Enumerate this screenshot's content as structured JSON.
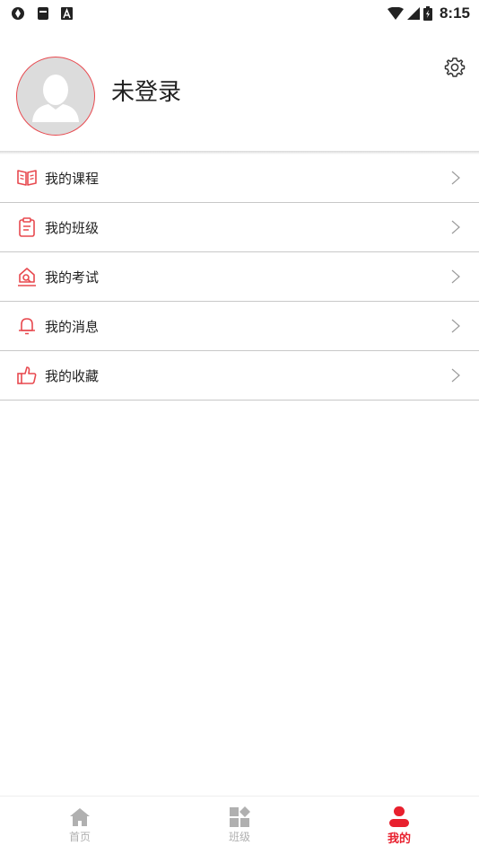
{
  "status_bar": {
    "time": "8:15",
    "icons_left": [
      "sync-icon",
      "sim-icon",
      "a-icon"
    ],
    "icons_right": [
      "wifi-icon",
      "signal-icon",
      "battery-icon"
    ]
  },
  "header": {
    "username": "未登录",
    "avatar_icon": "default-avatar-icon",
    "settings_icon": "gear-icon"
  },
  "menu": {
    "items": [
      {
        "label": "我的课程",
        "icon": "book-icon"
      },
      {
        "label": "我的班级",
        "icon": "clipboard-icon"
      },
      {
        "label": "我的考试",
        "icon": "exam-icon"
      },
      {
        "label": "我的消息",
        "icon": "bell-icon"
      },
      {
        "label": "我的收藏",
        "icon": "thumbs-up-icon"
      }
    ]
  },
  "bottom_nav": {
    "items": [
      {
        "label": "首页",
        "icon": "home-icon",
        "active": false
      },
      {
        "label": "班级",
        "icon": "grid-icon",
        "active": false
      },
      {
        "label": "我的",
        "icon": "person-icon",
        "active": true
      }
    ]
  },
  "colors": {
    "accent": "#e8202e",
    "icon_red": "#e8494f",
    "divider": "#c8c8c8",
    "nav_inactive": "#b0b0b0"
  }
}
